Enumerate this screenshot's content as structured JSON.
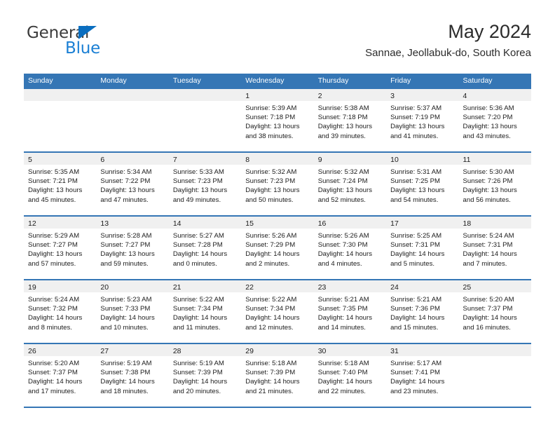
{
  "brand": {
    "name_part1": "General",
    "name_part2": "Blue",
    "triangle_icon": "triangle-icon",
    "accent_color": "#1a7fd4"
  },
  "header": {
    "title": "May 2024",
    "subtitle": "Sannae, Jeollabuk-do, South Korea"
  },
  "calendar": {
    "header_color": "#3576b5",
    "day_band_color": "#f0f0f0",
    "weekday_headers": [
      "Sunday",
      "Monday",
      "Tuesday",
      "Wednesday",
      "Thursday",
      "Friday",
      "Saturday"
    ],
    "weeks": [
      [
        {
          "day": "",
          "lines": []
        },
        {
          "day": "",
          "lines": []
        },
        {
          "day": "",
          "lines": []
        },
        {
          "day": "1",
          "lines": [
            "Sunrise: 5:39 AM",
            "Sunset: 7:18 PM",
            "Daylight: 13 hours",
            "and 38 minutes."
          ]
        },
        {
          "day": "2",
          "lines": [
            "Sunrise: 5:38 AM",
            "Sunset: 7:18 PM",
            "Daylight: 13 hours",
            "and 39 minutes."
          ]
        },
        {
          "day": "3",
          "lines": [
            "Sunrise: 5:37 AM",
            "Sunset: 7:19 PM",
            "Daylight: 13 hours",
            "and 41 minutes."
          ]
        },
        {
          "day": "4",
          "lines": [
            "Sunrise: 5:36 AM",
            "Sunset: 7:20 PM",
            "Daylight: 13 hours",
            "and 43 minutes."
          ]
        }
      ],
      [
        {
          "day": "5",
          "lines": [
            "Sunrise: 5:35 AM",
            "Sunset: 7:21 PM",
            "Daylight: 13 hours",
            "and 45 minutes."
          ]
        },
        {
          "day": "6",
          "lines": [
            "Sunrise: 5:34 AM",
            "Sunset: 7:22 PM",
            "Daylight: 13 hours",
            "and 47 minutes."
          ]
        },
        {
          "day": "7",
          "lines": [
            "Sunrise: 5:33 AM",
            "Sunset: 7:23 PM",
            "Daylight: 13 hours",
            "and 49 minutes."
          ]
        },
        {
          "day": "8",
          "lines": [
            "Sunrise: 5:32 AM",
            "Sunset: 7:23 PM",
            "Daylight: 13 hours",
            "and 50 minutes."
          ]
        },
        {
          "day": "9",
          "lines": [
            "Sunrise: 5:32 AM",
            "Sunset: 7:24 PM",
            "Daylight: 13 hours",
            "and 52 minutes."
          ]
        },
        {
          "day": "10",
          "lines": [
            "Sunrise: 5:31 AM",
            "Sunset: 7:25 PM",
            "Daylight: 13 hours",
            "and 54 minutes."
          ]
        },
        {
          "day": "11",
          "lines": [
            "Sunrise: 5:30 AM",
            "Sunset: 7:26 PM",
            "Daylight: 13 hours",
            "and 56 minutes."
          ]
        }
      ],
      [
        {
          "day": "12",
          "lines": [
            "Sunrise: 5:29 AM",
            "Sunset: 7:27 PM",
            "Daylight: 13 hours",
            "and 57 minutes."
          ]
        },
        {
          "day": "13",
          "lines": [
            "Sunrise: 5:28 AM",
            "Sunset: 7:27 PM",
            "Daylight: 13 hours",
            "and 59 minutes."
          ]
        },
        {
          "day": "14",
          "lines": [
            "Sunrise: 5:27 AM",
            "Sunset: 7:28 PM",
            "Daylight: 14 hours",
            "and 0 minutes."
          ]
        },
        {
          "day": "15",
          "lines": [
            "Sunrise: 5:26 AM",
            "Sunset: 7:29 PM",
            "Daylight: 14 hours",
            "and 2 minutes."
          ]
        },
        {
          "day": "16",
          "lines": [
            "Sunrise: 5:26 AM",
            "Sunset: 7:30 PM",
            "Daylight: 14 hours",
            "and 4 minutes."
          ]
        },
        {
          "day": "17",
          "lines": [
            "Sunrise: 5:25 AM",
            "Sunset: 7:31 PM",
            "Daylight: 14 hours",
            "and 5 minutes."
          ]
        },
        {
          "day": "18",
          "lines": [
            "Sunrise: 5:24 AM",
            "Sunset: 7:31 PM",
            "Daylight: 14 hours",
            "and 7 minutes."
          ]
        }
      ],
      [
        {
          "day": "19",
          "lines": [
            "Sunrise: 5:24 AM",
            "Sunset: 7:32 PM",
            "Daylight: 14 hours",
            "and 8 minutes."
          ]
        },
        {
          "day": "20",
          "lines": [
            "Sunrise: 5:23 AM",
            "Sunset: 7:33 PM",
            "Daylight: 14 hours",
            "and 10 minutes."
          ]
        },
        {
          "day": "21",
          "lines": [
            "Sunrise: 5:22 AM",
            "Sunset: 7:34 PM",
            "Daylight: 14 hours",
            "and 11 minutes."
          ]
        },
        {
          "day": "22",
          "lines": [
            "Sunrise: 5:22 AM",
            "Sunset: 7:34 PM",
            "Daylight: 14 hours",
            "and 12 minutes."
          ]
        },
        {
          "day": "23",
          "lines": [
            "Sunrise: 5:21 AM",
            "Sunset: 7:35 PM",
            "Daylight: 14 hours",
            "and 14 minutes."
          ]
        },
        {
          "day": "24",
          "lines": [
            "Sunrise: 5:21 AM",
            "Sunset: 7:36 PM",
            "Daylight: 14 hours",
            "and 15 minutes."
          ]
        },
        {
          "day": "25",
          "lines": [
            "Sunrise: 5:20 AM",
            "Sunset: 7:37 PM",
            "Daylight: 14 hours",
            "and 16 minutes."
          ]
        }
      ],
      [
        {
          "day": "26",
          "lines": [
            "Sunrise: 5:20 AM",
            "Sunset: 7:37 PM",
            "Daylight: 14 hours",
            "and 17 minutes."
          ]
        },
        {
          "day": "27",
          "lines": [
            "Sunrise: 5:19 AM",
            "Sunset: 7:38 PM",
            "Daylight: 14 hours",
            "and 18 minutes."
          ]
        },
        {
          "day": "28",
          "lines": [
            "Sunrise: 5:19 AM",
            "Sunset: 7:39 PM",
            "Daylight: 14 hours",
            "and 20 minutes."
          ]
        },
        {
          "day": "29",
          "lines": [
            "Sunrise: 5:18 AM",
            "Sunset: 7:39 PM",
            "Daylight: 14 hours",
            "and 21 minutes."
          ]
        },
        {
          "day": "30",
          "lines": [
            "Sunrise: 5:18 AM",
            "Sunset: 7:40 PM",
            "Daylight: 14 hours",
            "and 22 minutes."
          ]
        },
        {
          "day": "31",
          "lines": [
            "Sunrise: 5:17 AM",
            "Sunset: 7:41 PM",
            "Daylight: 14 hours",
            "and 23 minutes."
          ]
        },
        {
          "day": "",
          "lines": []
        }
      ]
    ]
  }
}
